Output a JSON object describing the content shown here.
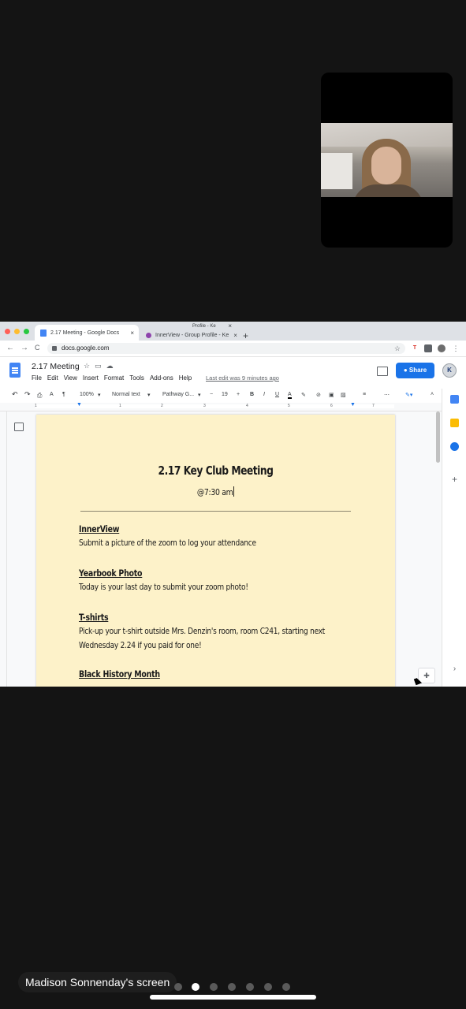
{
  "browser": {
    "tabs": [
      {
        "title": "2.17 Meeting - Google Docs",
        "close": "×"
      },
      {
        "title": "InnerView - Group Profile - Ke",
        "close": "×"
      },
      {
        "title": "Profile - Ke",
        "close": "×"
      }
    ],
    "new_tab": "+",
    "url": "docs.google.com",
    "nav": {
      "back": "←",
      "forward": "→",
      "reload": "C"
    }
  },
  "docs": {
    "title": "2.17 Meeting",
    "menus": [
      "File",
      "Edit",
      "View",
      "Insert",
      "Format",
      "Tools",
      "Add-ons",
      "Help"
    ],
    "last_edit": "Last edit was 9 minutes ago",
    "share_label": "Share",
    "toolbar": {
      "zoom": "100%",
      "style": "Normal text",
      "font": "Pathway G...",
      "size": "19",
      "minus": "−",
      "plus": "+",
      "bold": "B",
      "italic": "I",
      "underline": "U",
      "color": "A"
    },
    "ruler_numbers": [
      "1",
      "1",
      "2",
      "3",
      "4",
      "5",
      "6",
      "7"
    ]
  },
  "document": {
    "heading": "2.17 Key Club Meeting",
    "time": "@7:30 am",
    "sections": [
      {
        "title": "InnerView",
        "body": "Submit a picture of the zoom to log your attendance"
      },
      {
        "title": "Yearbook Photo",
        "body": "Today is your last day to submit your zoom photo!"
      },
      {
        "title": "T-shirts",
        "body": "Pick-up your t-shirt outside Mrs. Denzin's room, room C241, starting next Wednesday 2.24 if you paid for one!"
      },
      {
        "title": "Black History Month",
        "body": ""
      }
    ]
  },
  "meeting": {
    "caption": "Madison Sonnenday's screen",
    "page_count": 7,
    "active_page": 2
  }
}
